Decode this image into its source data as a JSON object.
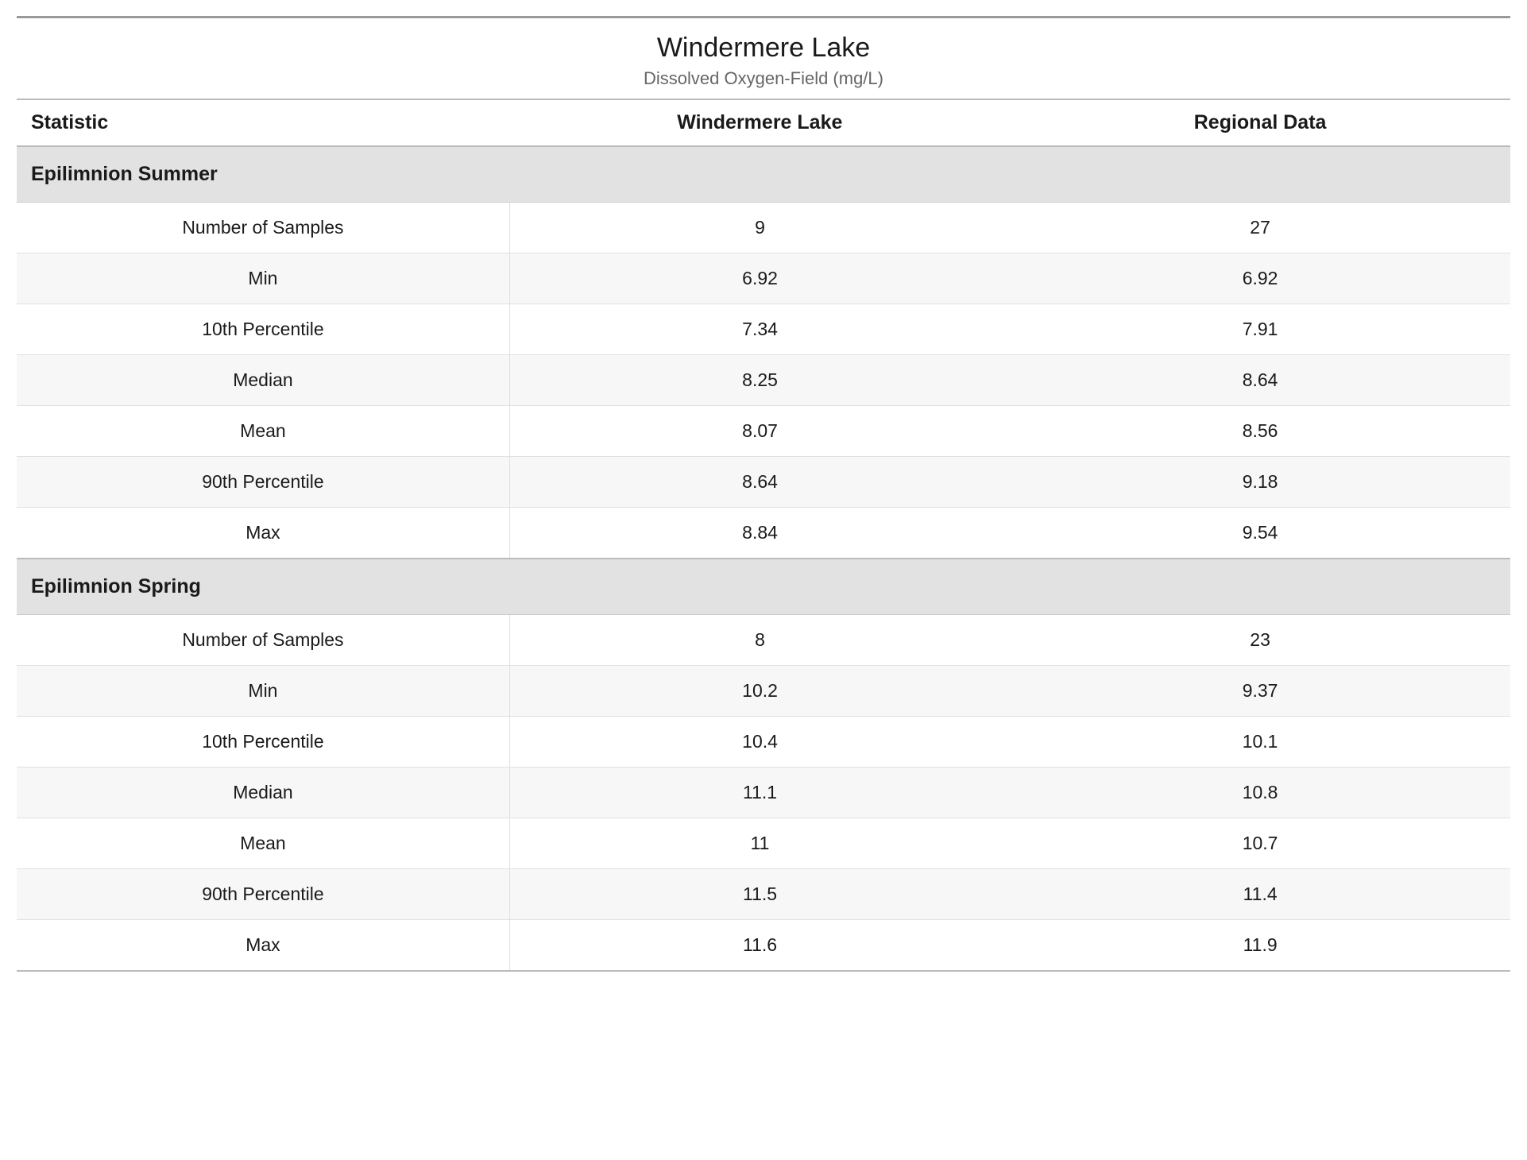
{
  "title": {
    "main": "Windermere Lake",
    "sub": "Dissolved Oxygen-Field (mg/L)"
  },
  "columns": {
    "stat": "Statistic",
    "lake": "Windermere Lake",
    "regional": "Regional Data"
  },
  "groups": [
    {
      "name": "Epilimnion Summer",
      "rows": [
        {
          "stat": "Number of Samples",
          "lake": "9",
          "regional": "27"
        },
        {
          "stat": "Min",
          "lake": "6.92",
          "regional": "6.92"
        },
        {
          "stat": "10th Percentile",
          "lake": "7.34",
          "regional": "7.91"
        },
        {
          "stat": "Median",
          "lake": "8.25",
          "regional": "8.64"
        },
        {
          "stat": "Mean",
          "lake": "8.07",
          "regional": "8.56"
        },
        {
          "stat": "90th Percentile",
          "lake": "8.64",
          "regional": "9.18"
        },
        {
          "stat": "Max",
          "lake": "8.84",
          "regional": "9.54"
        }
      ]
    },
    {
      "name": "Epilimnion Spring",
      "rows": [
        {
          "stat": "Number of Samples",
          "lake": "8",
          "regional": "23"
        },
        {
          "stat": "Min",
          "lake": "10.2",
          "regional": "9.37"
        },
        {
          "stat": "10th Percentile",
          "lake": "10.4",
          "regional": "10.1"
        },
        {
          "stat": "Median",
          "lake": "11.1",
          "regional": "10.8"
        },
        {
          "stat": "Mean",
          "lake": "11",
          "regional": "10.7"
        },
        {
          "stat": "90th Percentile",
          "lake": "11.5",
          "regional": "11.4"
        },
        {
          "stat": "Max",
          "lake": "11.6",
          "regional": "11.9"
        }
      ]
    }
  ]
}
